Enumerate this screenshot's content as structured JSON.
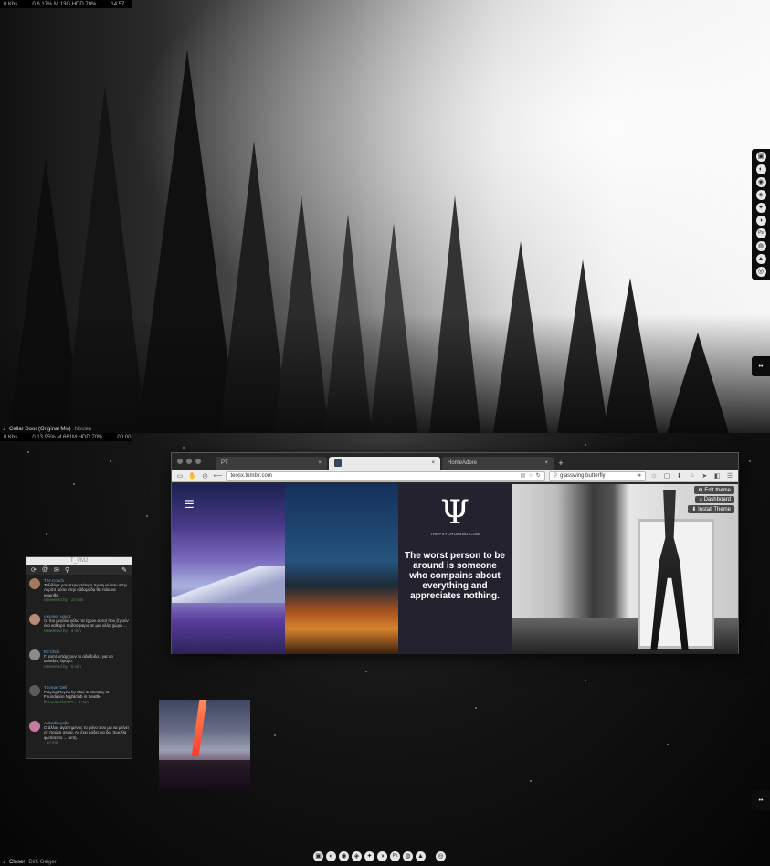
{
  "top_screen": {
    "status": {
      "net": "0 Kbs",
      "cpu_mem_hdd": "0 6.17% M 13G HDD 70%",
      "time": "14:57"
    },
    "now_playing": {
      "track": "Cellar Door (Original Mix)",
      "artist": "Noclen"
    }
  },
  "bottom_screen": {
    "status": {
      "net": "0 Kbs",
      "cpu_mem_hdd": "0 13.95% M 661M HDD 70%",
      "time": "00:00"
    },
    "now_playing": {
      "track": "Closer",
      "artist": "Dirk Geiger"
    }
  },
  "dock": {
    "icons": [
      {
        "name": "app-icon-1",
        "glyph": "▣"
      },
      {
        "name": "app-icon-2",
        "glyph": "◐"
      },
      {
        "name": "app-icon-3",
        "glyph": "◉"
      },
      {
        "name": "app-icon-4",
        "glyph": "◈"
      },
      {
        "name": "twitter-icon",
        "glyph": "✦"
      },
      {
        "name": "app-icon-6",
        "glyph": "◑"
      },
      {
        "name": "photoshop-icon",
        "glyph": "Ps"
      },
      {
        "name": "app-icon-8",
        "glyph": "◍"
      },
      {
        "name": "app-icon-9",
        "glyph": "▲"
      },
      {
        "name": "app-icon-10",
        "glyph": "◎"
      }
    ],
    "eye_glyph": "••"
  },
  "browser": {
    "tabs": [
      {
        "label": "PT",
        "close": "×"
      },
      {
        "label": "",
        "close": "×"
      },
      {
        "label": "HomeAdore",
        "close": "×"
      }
    ],
    "new_tab": "+",
    "url": "teosx.tumblr.com",
    "search_value": "glasswing butterfly",
    "tumblr_buttons": {
      "edit": "Edit theme",
      "dashboard": "Dashboard",
      "install": "Install Theme"
    },
    "menu_glyph": "☰",
    "posts": {
      "psi": "Ψ",
      "site": "THEPSYCHOMIND.COM",
      "quote": "The worst person to be around is someone who compains about everything and appreciates nothing."
    }
  },
  "twitter": {
    "title": "T_VMJ",
    "toolbar_icons": [
      "⟳",
      "@",
      "✉",
      "⚲",
      "✎"
    ],
    "tweets": [
      {
        "name": "The Coach",
        "text": "Ταξιδέψε μου περισσότερο προτιμούσαν στην Ακρόπ μέσα στην εβδομάδα θα πάει να κοιμηθεί.",
        "meta": "retweeted by",
        "time": "10 min"
      },
      {
        "name": "ο κυριος μανος",
        "text": "τα πιο μεγάλα γέλια τα έχουν αυτοί που ζητούν ένα καθαρό ποδόσφαιρο σε μια αλλη χώρα ...",
        "meta": "retweeted by",
        "time": "4 min"
      },
      {
        "name": "Ed Chris",
        "text": "Γ! αυτό υπάρχουν το αδιέξοδα...για να αλλάξεις δρόμο.",
        "meta": "retweeted by",
        "time": "5 min"
      },
      {
        "name": "Thomas Deli",
        "text": "Playing Reyna by Max & Monday at Foundation Nightclub in Seattle",
        "meta": "fb.me/3LFkKFPn",
        "time": "8 min"
      },
      {
        "name": "Aubadiaryaβα",
        "text": "Ο άλλος αγαπημένος το μόνο που μα να μείνει σε πρώτη σειρα. Αν έχει ρόδες να δω πως θα φωτίσει το ... μετη.",
        "meta": "",
        "time": "12 min"
      }
    ]
  }
}
